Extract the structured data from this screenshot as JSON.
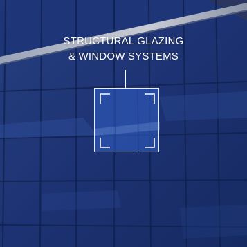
{
  "caption": {
    "line1": "STRUCTURAL GLAZING",
    "line2": "& WINDOW SYSTEMS"
  },
  "icon": "glazing-frame-icon",
  "colors": {
    "background": "#1b2f68",
    "glass_highlight": "#2e5cbe",
    "text": "#ffffff"
  }
}
